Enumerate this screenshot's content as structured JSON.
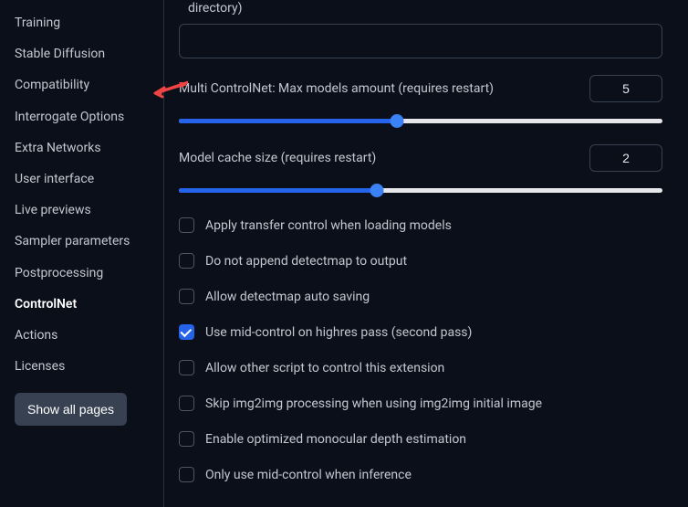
{
  "sidebar": {
    "items": [
      {
        "label": "Training"
      },
      {
        "label": "Stable Diffusion"
      },
      {
        "label": "Compatibility"
      },
      {
        "label": "Interrogate Options"
      },
      {
        "label": "Extra Networks"
      },
      {
        "label": "User interface"
      },
      {
        "label": "Live previews"
      },
      {
        "label": "Sampler parameters"
      },
      {
        "label": "Postprocessing"
      },
      {
        "label": "ControlNet"
      },
      {
        "label": "Actions"
      },
      {
        "label": "Licenses"
      }
    ],
    "active_index": 9,
    "show_all_label": "Show all pages"
  },
  "settings": {
    "truncated_top_label": "directory)",
    "text_field_value": "",
    "slider1": {
      "label": "Multi ControlNet: Max models amount (requires restart)",
      "value": 5,
      "fill_pct": 45
    },
    "slider2": {
      "label": "Model cache size (requires restart)",
      "value": 2,
      "fill_pct": 41
    },
    "checks": [
      {
        "label": "Apply transfer control when loading models",
        "checked": false
      },
      {
        "label": "Do not append detectmap to output",
        "checked": false
      },
      {
        "label": "Allow detectmap auto saving",
        "checked": false
      },
      {
        "label": "Use mid-control on highres pass (second pass)",
        "checked": true
      },
      {
        "label": "Allow other script to control this extension",
        "checked": false
      },
      {
        "label": "Skip img2img processing when using img2img initial image",
        "checked": false
      },
      {
        "label": "Enable optimized monocular depth estimation",
        "checked": false
      },
      {
        "label": "Only use mid-control when inference",
        "checked": false
      }
    ]
  }
}
